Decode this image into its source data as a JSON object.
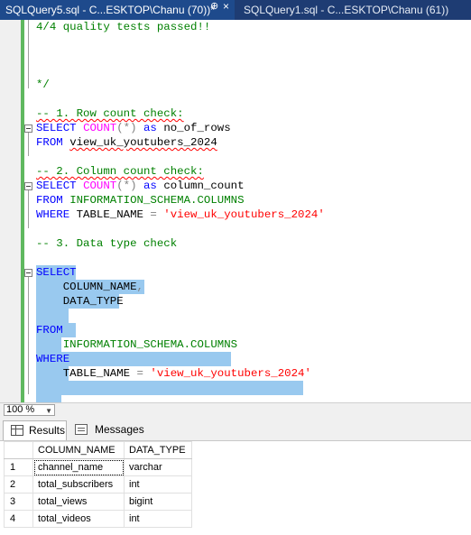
{
  "tabs": [
    {
      "title": "SQLQuery5.sql - C...ESKTOP\\Chanu (70))*",
      "pin": "⊕",
      "close": "×",
      "active": true
    },
    {
      "title": "SQLQuery1.sql - C...ESKTOP\\Chanu (61))",
      "active": false
    }
  ],
  "editor": {
    "lines": {
      "l0": "4/4 quality tests passed!!",
      "l4": "*/",
      "l6": "-- 1. Row count check:",
      "l7_kw": "SELECT",
      "l7_fn": "COUNT",
      "l7_rest1": "(*)",
      "l7_as": "as",
      "l7_id": "no_of_rows",
      "l8_kw": "FROM",
      "l8_id": "view_uk_youtubers_2024",
      "l10": "-- 2. Column count check:",
      "l11_kw": "SELECT",
      "l11_fn": "COUNT",
      "l11_rest1": "(*)",
      "l11_as": "as",
      "l11_id": "column_count",
      "l12_kw": "FROM",
      "l12_id": "INFORMATION_SCHEMA.COLUMNS",
      "l13_kw": "WHERE",
      "l13_id": "TABLE_NAME",
      "l13_eq": "=",
      "l13_str": "'view_uk_youtubers_2024'",
      "l15": "-- 3. Data type check",
      "l17": "SELECT",
      "l18_id": "COLUMN_NAME",
      "l18_comma": ",",
      "l19": "DATA_TYPE",
      "l22": "FROM",
      "l23": "INFORMATION_SCHEMA.COLUMNS",
      "l24": "WHERE",
      "l25_id": "TABLE_NAME",
      "l25_eq": "=",
      "l25_str": "'view_uk_youtubers_2024'"
    }
  },
  "zoom": {
    "value": "100 %",
    "arrow": "▼"
  },
  "results_tabs": {
    "results": "Results",
    "messages": "Messages"
  },
  "grid": {
    "columns": [
      "COLUMN_NAME",
      "DATA_TYPE"
    ],
    "rows": [
      {
        "n": "1",
        "column_name": "channel_name",
        "data_type": "varchar"
      },
      {
        "n": "2",
        "column_name": "total_subscribers",
        "data_type": "int"
      },
      {
        "n": "3",
        "column_name": "total_views",
        "data_type": "bigint"
      },
      {
        "n": "4",
        "column_name": "total_videos",
        "data_type": "int"
      }
    ]
  },
  "colors": {
    "keyword": "#0000ff",
    "function": "#ff00ff",
    "comment": "#008000",
    "string": "#ff0000",
    "selection": "#99c9ef",
    "tabbar": "#1e3c73"
  }
}
